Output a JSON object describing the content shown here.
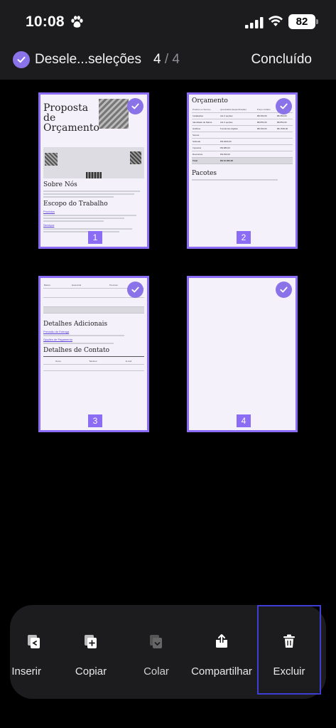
{
  "status": {
    "time": "10:08",
    "battery": "82"
  },
  "header": {
    "selection_label": "Desele...seleções",
    "page_current": "4",
    "page_separator": "/",
    "page_total": "4",
    "done_label": "Concluído"
  },
  "colors": {
    "accent": "#8a73e8",
    "border": "#8b6cf5",
    "highlight": "#3d3fd4"
  },
  "pages": [
    {
      "number": "1",
      "title": "Proposta de Orçamento",
      "section1": "Sobre Nós",
      "section2": "Escopo do Trabalho",
      "link1": "Produtos",
      "link2": "Serviços"
    },
    {
      "number": "2",
      "title": "Orçamento",
      "table": {
        "headers": [
          "Produto ou Serviço",
          "Quantidade (Especificação)",
          "Preço Unitário",
          "Total"
        ],
        "rows": [
          [
            "Instalações",
            "Até 3 opções",
            "R$ 350,00",
            "R$ 350,00"
          ],
          [
            "Identidade de Marca",
            "Até 3 opções",
            "R$ 850,00",
            "R$ 850,00"
          ],
          [
            "Gráficos",
            "5 anúncios digitais",
            "R$ 300,00",
            "R$ 1500,00"
          ],
          [
            "Somas",
            "",
            "",
            ""
          ],
          [
            "Subtotal",
            "R$ 9400,00",
            "",
            ""
          ],
          [
            "Impostos",
            "R$ 980,00",
            "",
            ""
          ],
          [
            "Descontos",
            "R$ 490,00",
            "",
            ""
          ],
          [
            "Total",
            "R$ 10.060,00",
            "",
            ""
          ]
        ]
      },
      "section": "Pacotes"
    },
    {
      "number": "3",
      "tiers": [
        "Básico",
        "Essencial",
        "Premium"
      ],
      "section1": "Detalhes Adicionais",
      "link1": "Previsão de Entrega",
      "link2": "Opções de Pagamento",
      "section2": "Detalhes de Contato",
      "contact_headers": [
        "Nome",
        "Telefone",
        "E-mail"
      ]
    },
    {
      "number": "4"
    }
  ],
  "toolbar": {
    "insert": "Inserir",
    "copy": "Copiar",
    "paste": "Colar",
    "share": "Compartilhar",
    "delete": "Excluir"
  }
}
